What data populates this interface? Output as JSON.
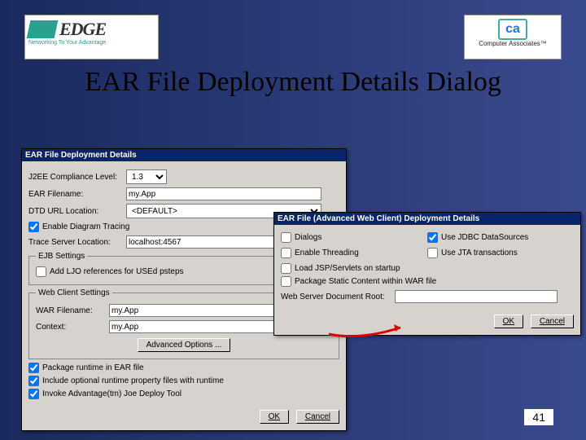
{
  "slide": {
    "title": "EAR File Deployment Details Dialog",
    "number": "41",
    "edgeLogoText": "EDGE",
    "edgeTagline": "Networking To Your Advantage",
    "caLogo": "ca",
    "caText": "Computer Associates™"
  },
  "mainDialog": {
    "title": "EAR File Deployment Details",
    "j2eeLabel": "J2EE Compliance Level:",
    "j2eeValue": "1.3",
    "earFilenameLabel": "EAR Filename:",
    "earFilenameValue": "my.App",
    "dtdLabel": "DTD URL Location:",
    "dtdValue": "<DEFAULT>",
    "diagramTracing": "Enable Diagram Tracing",
    "traceServerLabel": "Trace Server Location:",
    "traceServerValue": "localhost:4567",
    "ejbLegend": "EJB Settings",
    "addLjo": "Add LJO references for USEd psteps",
    "webLegend": "Web Client Settings",
    "warFilenameLabel": "WAR Filename:",
    "warFilenameValue": "my.App",
    "contextLabel": "Context:",
    "contextValue": "my.App",
    "advancedBtn": "Advanced Options ...",
    "pkgRuntime": "Package runtime in EAR file",
    "includeOptional": "Include optional runtime property files with runtime",
    "invokeJoe": "Invoke Advantage(tm) Joe Deploy Tool",
    "okBtn": "OK",
    "cancelBtn": "Cancel"
  },
  "advDialog": {
    "title": "EAR File (Advanced Web Client) Deployment Details",
    "dialogs": "Dialogs",
    "useJdbc": "Use JDBC DataSources",
    "enableThreading": "Enable Threading",
    "useJta": "Use JTA transactions",
    "loadJsp": "Load JSP/Servlets on startup",
    "packageStatic": "Package Static Content within WAR file",
    "docRootLabel": "Web Server Document Root:",
    "docRootValue": "",
    "okBtn": "OK",
    "cancelBtn": "Cancel"
  }
}
